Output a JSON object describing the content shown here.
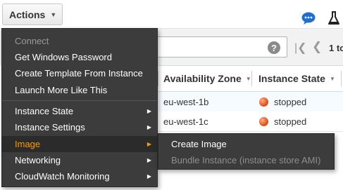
{
  "toolbar": {
    "actions_label": "Actions",
    "chat_icon": "chat-bubble-icon",
    "flask_icon": "flask-icon"
  },
  "filter": {
    "help_symbol": "?",
    "first_symbol": "|❮",
    "prev_symbol": "❮",
    "page_text": "1 to"
  },
  "table": {
    "columns": [
      "Availability Zone",
      "Instance State"
    ],
    "rows": [
      {
        "zone": "eu-west-1b",
        "state": "stopped"
      },
      {
        "zone": "eu-west-1c",
        "state": "stopped"
      }
    ],
    "status_color": "#e2531c"
  },
  "menu": {
    "items": [
      {
        "label": "Connect",
        "disabled": true
      },
      {
        "label": "Get Windows Password"
      },
      {
        "label": "Create Template From Instance"
      },
      {
        "label": "Launch More Like This"
      },
      {
        "label": "Instance State",
        "submenu": true
      },
      {
        "label": "Instance Settings",
        "submenu": true
      },
      {
        "label": "Image",
        "submenu": true,
        "active": true
      },
      {
        "label": "Networking",
        "submenu": true
      },
      {
        "label": "CloudWatch Monitoring",
        "submenu": true
      }
    ],
    "active_color": "#ff9900"
  },
  "submenu": {
    "items": [
      {
        "label": "Create Image"
      },
      {
        "label": "Bundle Instance (instance store AMI)",
        "disabled": true
      }
    ]
  }
}
